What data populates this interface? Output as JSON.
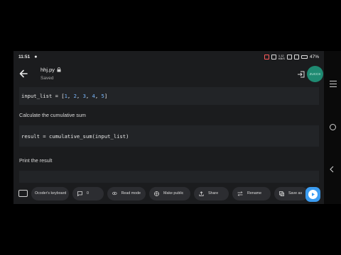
{
  "status_bar": {
    "time": "11:51",
    "battery": "47%",
    "network_top": "1.12",
    "network_bottom": "KB/S"
  },
  "header": {
    "file_name": "hhj.py",
    "save_status": "Saved",
    "avatar_text": "ZUCCS"
  },
  "cells": [
    {
      "type": "code",
      "tokens": [
        "input_list = [",
        "1",
        ", ",
        "2",
        ", ",
        "3",
        ", ",
        "4",
        ", ",
        "5",
        "]"
      ]
    },
    {
      "type": "text",
      "text": "Calculate the cumulative sum"
    },
    {
      "type": "code",
      "text": "result = cumulative_sum(input_list)"
    },
    {
      "type": "text",
      "text": "Print the result"
    }
  ],
  "toolbar": {
    "keyboard": "Ocoder's keyboard",
    "comments_count": "0",
    "read_mode": "Read mode",
    "make_public": "Make public",
    "share": "Share",
    "rename": "Rename",
    "save_as": "Save as"
  },
  "colors": {
    "background": "#1b1c1e",
    "code_bg": "#222427",
    "avatar": "#1f8a72",
    "run_button": "#3b9cf1",
    "number": "#79b8ff"
  }
}
